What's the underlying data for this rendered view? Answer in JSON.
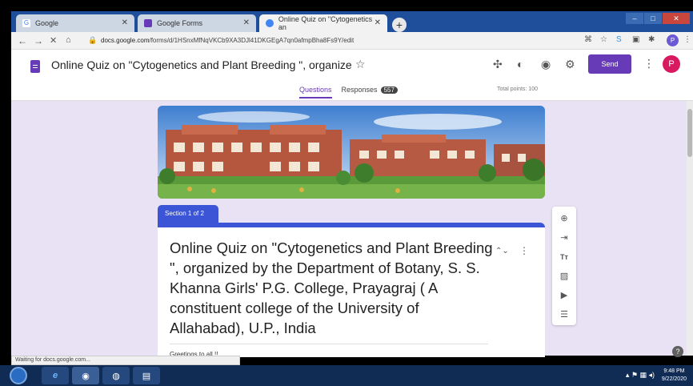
{
  "browser": {
    "tabs": [
      {
        "label": "Google",
        "fav_color": "#ffffff"
      },
      {
        "label": "Google Forms",
        "fav_color": "#673ab7"
      },
      {
        "label": "Online Quiz on \"Cytogenetics an",
        "fav_color": "#4285f4"
      }
    ],
    "new_tab": "+",
    "url_host": "docs.google.com",
    "url_path": "/forms/d/1HSnxMfNqVKCb9XA3DJl41DKGEgA7qn0afmpBha8Fs9Y/edit",
    "status": "Waiting for docs.google.com...",
    "profile_initial": "P"
  },
  "form": {
    "title": "Online Quiz on \"Cytogenetics and Plant Breeding \", organize",
    "tabs": [
      {
        "label": "Questions",
        "selected": true
      },
      {
        "label": "Responses",
        "badge": "557"
      }
    ],
    "total_points": "Total points: 100",
    "send_label": "Send",
    "avatar_initial": "P"
  },
  "section": {
    "label": "Section 1 of 2",
    "title": "Online Quiz on \"Cytogenetics and Plant Breeding \", organized by the Department of Botany, S. S. Khanna Girls' P.G. College, Prayagraj ( A constituent college of the University of Allahabad), U.P., India",
    "description": "Greetings to all !!"
  },
  "taskbar": {
    "time": "9:48 PM",
    "date": "9/22/2020"
  },
  "colors": {
    "accent": "#673ab7",
    "section": "#3b55d6",
    "page_bg": "#e9e2f4",
    "avatar": "#d81b60"
  }
}
